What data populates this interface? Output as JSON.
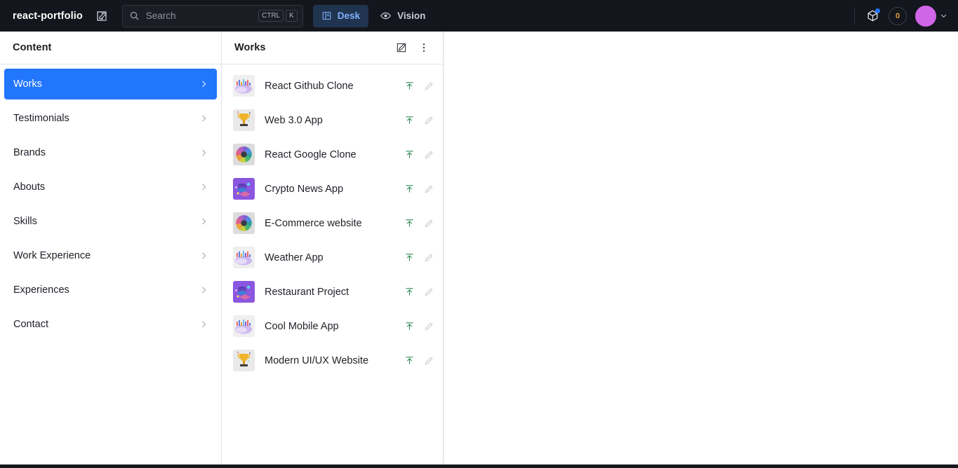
{
  "topbar": {
    "brand": "react-portfolio",
    "compose_icon": "compose-icon",
    "search": {
      "placeholder": "Search",
      "icon": "search-icon",
      "shortcut_keys": [
        "CTRL",
        "K"
      ]
    },
    "tabs": [
      {
        "label": "Desk",
        "icon": "desk-panels-icon",
        "active": true
      },
      {
        "label": "Vision",
        "icon": "eye-icon",
        "active": false
      }
    ],
    "package_icon": "package-cube-icon",
    "package_has_update_dot": true,
    "badge_count": "0",
    "avatar": "user-avatar",
    "avatar_color": "#d165e8",
    "chevron_icon": "chevron-down-icon"
  },
  "sidebar": {
    "title": "Content",
    "items": [
      {
        "label": "Works",
        "selected": true
      },
      {
        "label": "Testimonials",
        "selected": false
      },
      {
        "label": "Brands",
        "selected": false
      },
      {
        "label": "Abouts",
        "selected": false
      },
      {
        "label": "Skills",
        "selected": false
      },
      {
        "label": "Work Experience",
        "selected": false
      },
      {
        "label": "Experiences",
        "selected": false
      },
      {
        "label": "Contact",
        "selected": false
      }
    ],
    "chevron_icon": "chevron-right-icon"
  },
  "list_pane": {
    "title": "Works",
    "actions": [
      {
        "icon": "compose-create-icon",
        "name": "create-new-document-button"
      },
      {
        "icon": "more-vertical-icon",
        "name": "list-options-menu-button"
      }
    ],
    "documents": [
      {
        "title": "React Github Clone",
        "thumb": "landscape-abstract",
        "publish_icon": "publish-up-arrow-icon",
        "edit_icon": "pencil-edit-icon"
      },
      {
        "title": "Web 3.0 App",
        "thumb": "trophy",
        "publish_icon": "publish-up-arrow-icon",
        "edit_icon": "pencil-edit-icon"
      },
      {
        "title": "React Google Clone",
        "thumb": "pinwheel-aperture",
        "publish_icon": "publish-up-arrow-icon",
        "edit_icon": "pencil-edit-icon"
      },
      {
        "title": "Crypto News App",
        "thumb": "purple-isometric",
        "publish_icon": "publish-up-arrow-icon",
        "edit_icon": "pencil-edit-icon"
      },
      {
        "title": "E-Commerce website",
        "thumb": "pinwheel-aperture",
        "publish_icon": "publish-up-arrow-icon",
        "edit_icon": "pencil-edit-icon"
      },
      {
        "title": "Weather App",
        "thumb": "landscape-abstract",
        "publish_icon": "publish-up-arrow-icon",
        "edit_icon": "pencil-edit-icon"
      },
      {
        "title": "Restaurant Project",
        "thumb": "purple-isometric",
        "publish_icon": "publish-up-arrow-icon",
        "edit_icon": "pencil-edit-icon"
      },
      {
        "title": "Cool Mobile App",
        "thumb": "landscape-abstract",
        "publish_icon": "publish-up-arrow-icon",
        "edit_icon": "pencil-edit-icon"
      },
      {
        "title": "Modern UI/UX Website",
        "thumb": "trophy",
        "publish_icon": "publish-up-arrow-icon",
        "edit_icon": "pencil-edit-icon"
      }
    ]
  },
  "colors": {
    "accent_blue": "#2276fc",
    "topbar_bg": "#14161d",
    "active_tab_bg": "#20344f",
    "active_tab_text": "#7eb0ff",
    "publish_green": "#2e8b57"
  }
}
